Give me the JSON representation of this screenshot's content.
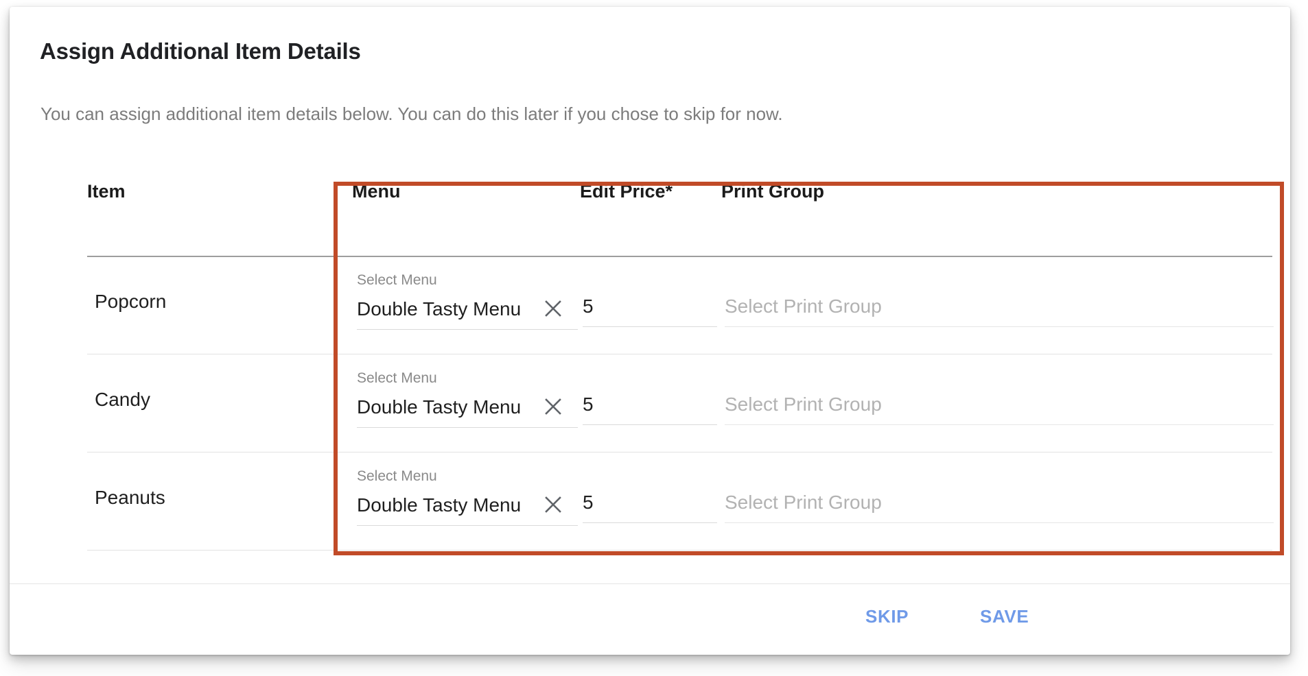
{
  "dialog": {
    "title": "Assign Additional Item Details",
    "subtitle": "You can assign additional item details below. You can do this later if you chose to skip for now."
  },
  "table": {
    "headers": {
      "item": "Item",
      "menu": "Menu",
      "price": "Edit Price*",
      "print_group": "Print Group"
    },
    "rows": [
      {
        "item": "Popcorn",
        "menu_label": "Select Menu",
        "menu_value": "Double Tasty Menu",
        "clear_icon": "close-icon",
        "price": "5",
        "print_group_placeholder": "Select Print Group",
        "print_group_value": ""
      },
      {
        "item": "Candy",
        "menu_label": "Select Menu",
        "menu_value": "Double Tasty Menu",
        "clear_icon": "close-icon",
        "price": "5",
        "print_group_placeholder": "Select Print Group",
        "print_group_value": ""
      },
      {
        "item": "Peanuts",
        "menu_label": "Select Menu",
        "menu_value": "Double Tasty Menu",
        "clear_icon": "close-icon",
        "price": "5",
        "print_group_placeholder": "Select Print Group",
        "print_group_value": ""
      }
    ]
  },
  "footer": {
    "skip_label": "SKIP",
    "save_label": "SAVE"
  },
  "colors": {
    "highlight_border": "#c14b28",
    "action_text": "#6f9ae8",
    "title_text": "#202124",
    "subtitle_text": "#7c7c7c",
    "placeholder_text": "#b2b2b2",
    "divider": "#e2e2e2"
  }
}
